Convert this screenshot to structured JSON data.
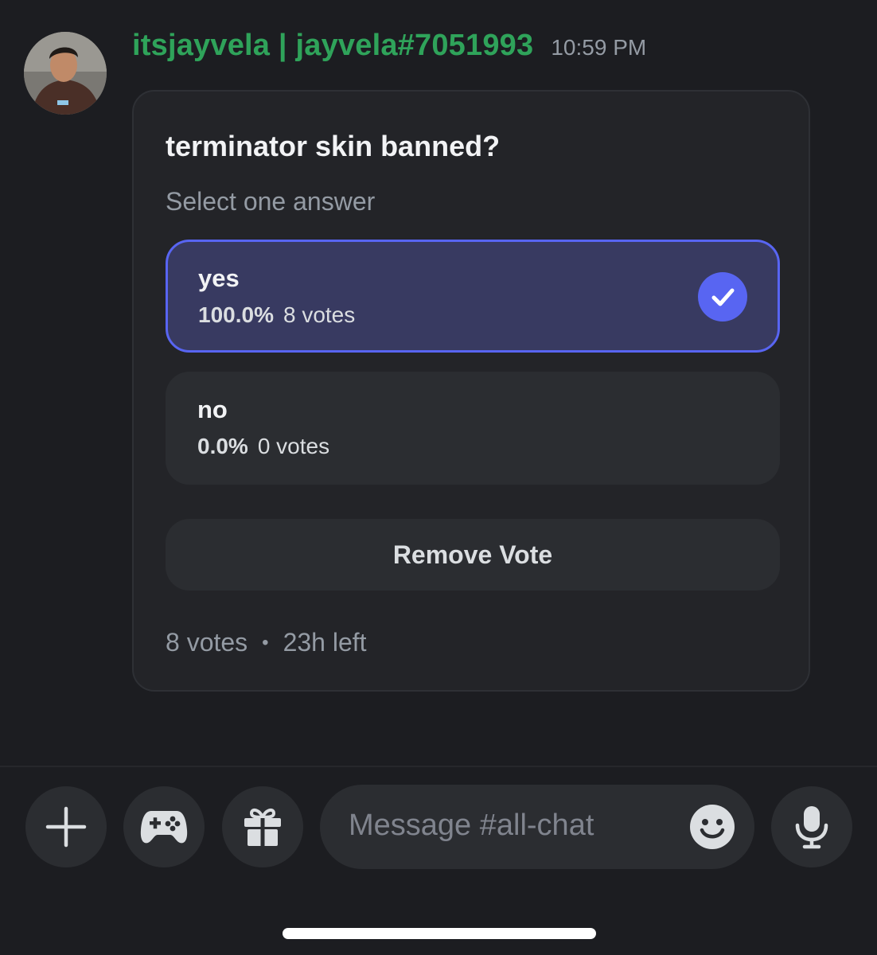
{
  "message": {
    "username": "itsjayvela | jayvela#7051993",
    "timestamp": "10:59 PM",
    "avatar_icon": "user-avatar"
  },
  "poll": {
    "question": "terminator skin banned?",
    "subtitle": "Select one answer",
    "answers": [
      {
        "label": "yes",
        "percent": "100.0%",
        "votes": "8 votes",
        "selected": true
      },
      {
        "label": "no",
        "percent": "0.0%",
        "votes": "0 votes",
        "selected": false
      }
    ],
    "remove_vote_label": "Remove Vote",
    "footer": {
      "total_votes": "8 votes",
      "separator": "•",
      "time_left": "23h left"
    }
  },
  "composer": {
    "placeholder": "Message #all-chat",
    "buttons": [
      "plus-icon",
      "gamepad-icon",
      "gift-icon",
      "emoji-icon",
      "microphone-icon"
    ]
  },
  "colors": {
    "accent": "#5865f2",
    "username": "#2fa35a",
    "background": "#1c1d21",
    "selected_answer": "#383a61"
  }
}
